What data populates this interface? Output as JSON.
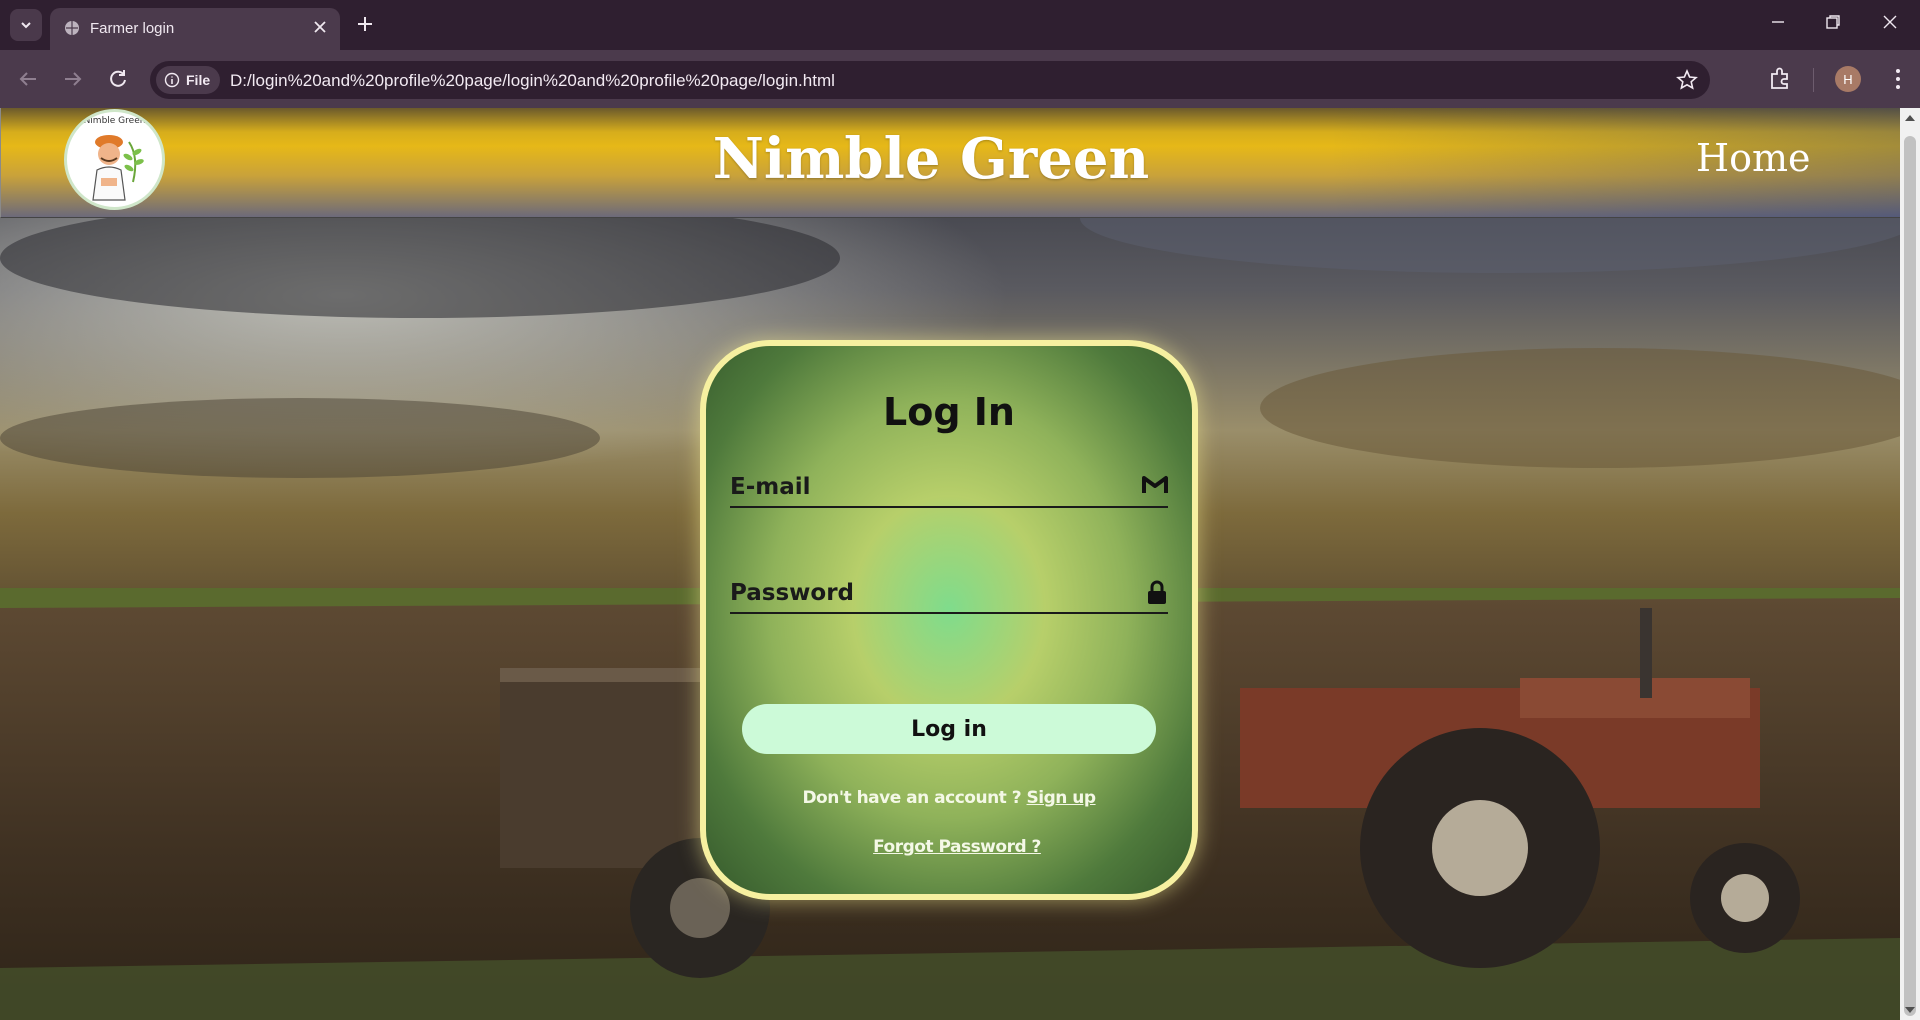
{
  "browser": {
    "tab_title": "Farmer login",
    "site_chip_label": "File",
    "url": "D:/login%20and%20profile%20page/login%20and%20profile%20page/login.html",
    "profile_initial": "H"
  },
  "header": {
    "brand": "Nimble Green",
    "home_link": "Home",
    "logo_text": "Nimble Green"
  },
  "login": {
    "title": "Log In",
    "email_placeholder": "E-mail",
    "password_placeholder": "Password",
    "submit_label": "Log in",
    "signup_prompt": "Don't have an account ?",
    "signup_link": "Sign up",
    "forgot_link": "Forgot Password ?"
  },
  "icons": {
    "email_field": "gmail-m-icon",
    "password_field": "lock-icon"
  },
  "colors": {
    "card_border": "#f6f0a0",
    "button_bg": "#ccfad8",
    "header_gold": "#e6b818"
  }
}
